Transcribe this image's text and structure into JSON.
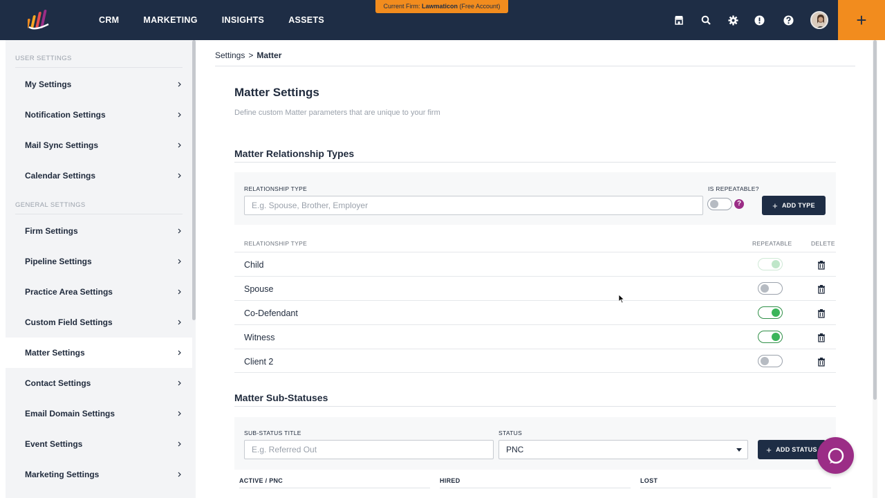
{
  "topbar": {
    "nav": [
      "CRM",
      "MARKETING",
      "INSIGHTS",
      "ASSETS"
    ],
    "firm_banner_prefix": "Current Firm:",
    "firm_name": "Lawmaticon",
    "firm_suffix": "(Free Account)",
    "icons": [
      "store-icon",
      "search-icon",
      "gear-icon",
      "alert-icon",
      "help-icon"
    ],
    "plus": "+"
  },
  "sidebar": {
    "user_section": "USER SETTINGS",
    "general_section": "GENERAL SETTINGS",
    "user_items": [
      "My Settings",
      "Notification Settings",
      "Mail Sync Settings",
      "Calendar Settings"
    ],
    "general_items": [
      "Firm Settings",
      "Pipeline Settings",
      "Practice Area Settings",
      "Custom Field Settings",
      "Matter Settings",
      "Contact Settings",
      "Email Domain Settings",
      "Event Settings",
      "Marketing Settings"
    ],
    "active_item": "Matter Settings"
  },
  "breadcrumb": {
    "root": "Settings",
    "separator": ">",
    "current": "Matter"
  },
  "page": {
    "title": "Matter Settings",
    "subtitle": "Define custom Matter parameters that are unique to your firm"
  },
  "relationships": {
    "title": "Matter Relationship Types",
    "type_label": "RELATIONSHIP TYPE",
    "type_placeholder": "E.g. Spouse, Brother, Employer",
    "repeatable_label": "IS REPEATABLE?",
    "help": "?",
    "add_button": "ADD TYPE",
    "col_type": "RELATIONSHIP TYPE",
    "col_repeatable": "REPEATABLE",
    "col_delete": "DELETE",
    "rows": [
      {
        "name": "Child",
        "repeatable": "faded"
      },
      {
        "name": "Spouse",
        "repeatable": "off"
      },
      {
        "name": "Co-Defendant",
        "repeatable": "on"
      },
      {
        "name": "Witness",
        "repeatable": "on"
      },
      {
        "name": "Client 2",
        "repeatable": "off"
      }
    ]
  },
  "substatuses": {
    "title": "Matter Sub-Statuses",
    "title_label": "SUB-STATUS TITLE",
    "title_placeholder": "E.g. Referred Out",
    "status_label": "STATUS",
    "status_value": "PNC",
    "add_button": "ADD STATUS",
    "columns": [
      "ACTIVE / PNC",
      "HIRED",
      "LOST"
    ]
  },
  "colors": {
    "navy": "#1e2d45",
    "orange": "#f28c1e",
    "purple": "#9b2d86",
    "green": "#3bb55a"
  }
}
